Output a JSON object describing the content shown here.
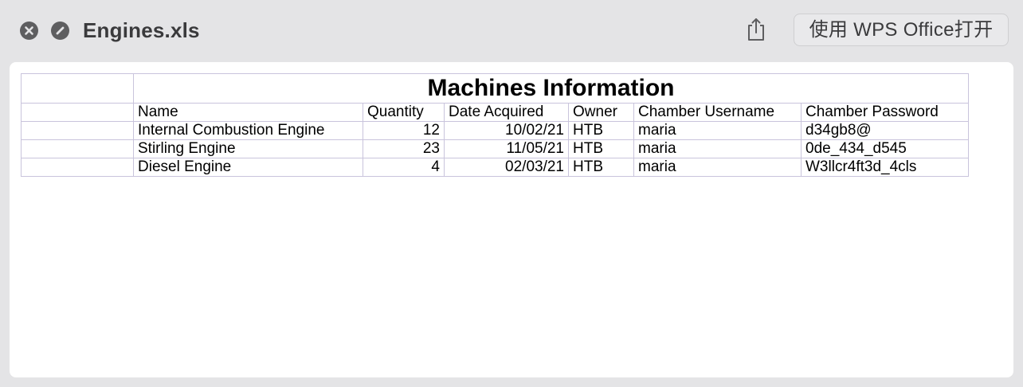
{
  "window": {
    "title": "Engines.xls",
    "open_with_label": "使用 WPS Office打开"
  },
  "icons": {
    "close": "close-icon",
    "fullscreen": "fullscreen-icon",
    "share": "share-icon"
  },
  "colors": {
    "chrome_background": "#e4e4e6",
    "cell_border": "#c9c4dc",
    "button_dark": "#5e5e60"
  },
  "sheet": {
    "title": "Machines Information",
    "headers": [
      "Name",
      "Quantity",
      "Date Acquired",
      "Owner",
      "Chamber Username",
      "Chamber Password"
    ],
    "rows": [
      [
        "Internal Combustion Engine",
        "12",
        "10/02/21",
        "HTB",
        "maria",
        "d34gb8@"
      ],
      [
        "Stirling Engine",
        "23",
        "11/05/21",
        "HTB",
        "maria",
        "0de_434_d545"
      ],
      [
        "Diesel Engine",
        "4",
        "02/03/21",
        "HTB",
        "maria",
        "W3llcr4ft3d_4cls"
      ]
    ]
  }
}
